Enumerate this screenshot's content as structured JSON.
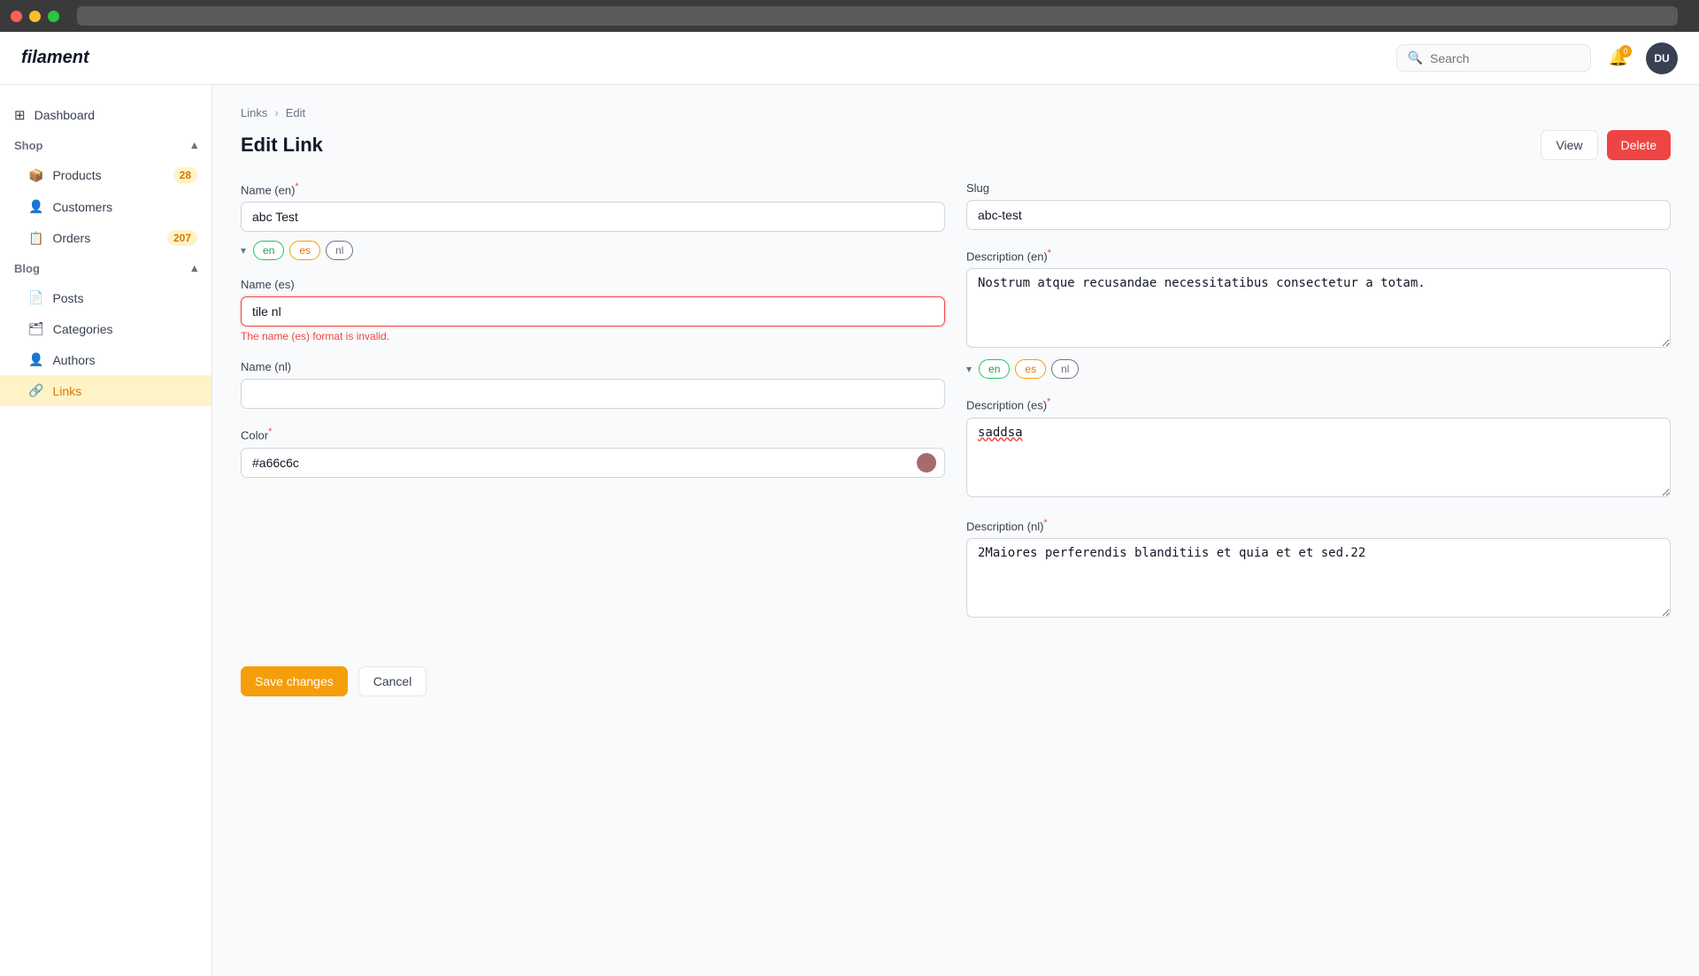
{
  "window": {
    "traffic_lights": [
      "red",
      "yellow",
      "green"
    ]
  },
  "topbar": {
    "logo": "filament",
    "search_placeholder": "Search",
    "notification_badge": "0",
    "avatar_initials": "DU"
  },
  "sidebar": {
    "dashboard_label": "Dashboard",
    "shop_section": "Shop",
    "blog_section": "Blog",
    "items": [
      {
        "id": "products",
        "label": "Products",
        "badge": "28"
      },
      {
        "id": "customers",
        "label": "Customers",
        "badge": null
      },
      {
        "id": "orders",
        "label": "Orders",
        "badge": "207"
      },
      {
        "id": "posts",
        "label": "Posts",
        "badge": null
      },
      {
        "id": "categories",
        "label": "Categories",
        "badge": null
      },
      {
        "id": "authors",
        "label": "Authors",
        "badge": null
      },
      {
        "id": "links",
        "label": "Links",
        "badge": null,
        "active": true
      }
    ]
  },
  "breadcrumb": {
    "links_label": "Links",
    "edit_label": "Edit"
  },
  "page": {
    "title": "Edit Link",
    "view_btn": "View",
    "delete_btn": "Delete"
  },
  "form": {
    "name_en_label": "Name (en)",
    "name_en_value": "abc Test",
    "lang_tabs_name": [
      "en",
      "es",
      "nl"
    ],
    "name_es_label": "Name (es)",
    "name_es_value": "tile nl",
    "name_es_error": "The name (es) format is invalid.",
    "name_nl_label": "Name (nl)",
    "name_nl_value": "",
    "slug_label": "Slug",
    "slug_value": "abc-test",
    "color_label": "Color",
    "color_value": "#a66c6c",
    "color_swatch": "#a66c6c",
    "description_en_label": "Description (en)",
    "description_en_value": "Nostrum atque recusandae necessitatibus consectetur a totam.",
    "lang_tabs_desc": [
      "en",
      "es",
      "nl"
    ],
    "description_es_label": "Description (es)",
    "description_es_value": "saddsa",
    "description_nl_label": "Description (nl)",
    "description_nl_value": "2Maiores perferendis blanditiis et quia et et sed.22",
    "save_btn": "Save changes",
    "cancel_btn": "Cancel"
  },
  "icons": {
    "search": "🔍",
    "bell": "🔔",
    "dashboard": "⊞",
    "shop": "🛍",
    "products": "📦",
    "customers": "👤",
    "orders": "📋",
    "blog": "📝",
    "posts": "📄",
    "categories": "🗂",
    "authors": "👤",
    "links": "🔗",
    "chevron_down": "▾",
    "chevron_right": "›"
  }
}
